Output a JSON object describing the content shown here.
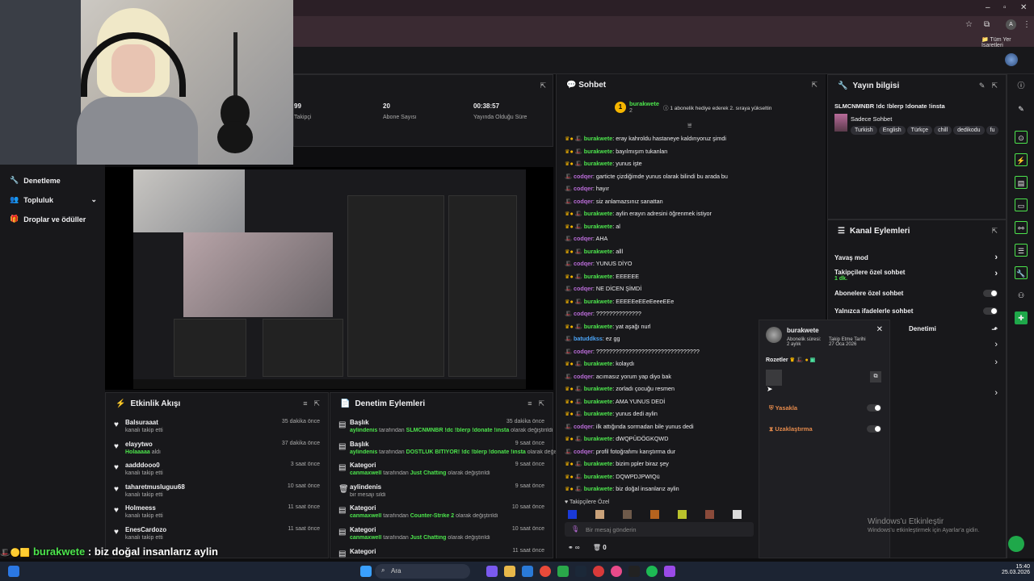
{
  "browser": {
    "bookmarks_label": "Tüm Yer İşaretleri",
    "window_controls": [
      "–",
      "▫",
      "✕"
    ]
  },
  "nav": {
    "items": [
      {
        "label": "Denetleme",
        "icon": "wrench-icon"
      },
      {
        "label": "Topluluk",
        "icon": "people-icon"
      },
      {
        "label": "Droplar ve ödüller",
        "icon": "gift-icon"
      }
    ]
  },
  "stats": {
    "items": [
      {
        "value": "99",
        "label": "Takipçi"
      },
      {
        "value": "20",
        "label": "Abone Sayısı"
      },
      {
        "value": "00:38:57",
        "label": "Yayında Olduğu Süre"
      }
    ]
  },
  "activity_feed": {
    "title": "Etkinlik Akışı",
    "items": [
      {
        "name": "Balsuraaat",
        "sub": "kanalı takip etti",
        "time": "35 dakika önce"
      },
      {
        "name": "elayytwo",
        "sub": "Holaaaaa",
        "sub2": " aldı",
        "time": "37 dakika önce"
      },
      {
        "name": "aadddooo0",
        "sub": "kanalı takip etti",
        "time": "3 saat önce"
      },
      {
        "name": "taharetmusluguu68",
        "sub": "kanalı takip etti",
        "time": "10 saat önce"
      },
      {
        "name": "Holmeess",
        "sub": "kanalı takip etti",
        "time": "11 saat önce"
      },
      {
        "name": "EnesCardozo",
        "sub": "kanalı takip etti",
        "time": "11 saat önce"
      }
    ]
  },
  "mod_actions": {
    "title": "Denetim Eylemleri",
    "items": [
      {
        "name": "Başlık",
        "user": "aylindenis",
        "mid": " tarafından ",
        "value": "SLMCNMNBR !dc !blerp !donate !insta",
        "suffix": " olarak değiştirildi",
        "time": "35 dakika önce"
      },
      {
        "name": "Başlık",
        "user": "aylindenis",
        "mid": " tarafından ",
        "value": "DOSTLUK BİTİYOR! !dc !blerp !donate !insta",
        "suffix": " olarak değiştirildi",
        "time": "9 saat önce"
      },
      {
        "name": "Kategori",
        "user": "canmaxwell",
        "mid": " tarafından ",
        "value": "Just Chatting",
        "suffix": " olarak değiştirildi",
        "time": "9 saat önce"
      },
      {
        "name": "aylindenis",
        "user": "",
        "mid": "",
        "value": "",
        "suffix": "bir mesajı sildi",
        "time": "9 saat önce"
      },
      {
        "name": "Kategori",
        "user": "canmaxwell",
        "mid": " tarafından ",
        "value": "Counter-Strike 2",
        "suffix": " olarak değiştirildi",
        "time": "10 saat önce"
      },
      {
        "name": "Kategori",
        "user": "canmaxwell",
        "mid": " tarafından ",
        "value": "Just Chatting",
        "suffix": " olarak değiştirildi",
        "time": "10 saat önce"
      },
      {
        "name": "Kategori",
        "user": "",
        "mid": "",
        "value": "",
        "suffix": "",
        "time": "11 saat önce"
      }
    ]
  },
  "chat": {
    "title": "Sohbet",
    "pinned_user": "burakwete",
    "pinned_count": "2",
    "pinned_text": "1 abonelik hediye ederek 2. sıraya yükseltin",
    "messages": [
      {
        "user": "burakwete",
        "cls": "user-burak",
        "text": "eray kahroldu hastaneye kaldırıyoruz şimdi"
      },
      {
        "user": "burakwete",
        "cls": "user-burak",
        "text": "bayılmışım tukanlan"
      },
      {
        "user": "burakwete",
        "cls": "user-burak",
        "text": "yunus işte"
      },
      {
        "user": "codqer",
        "cls": "user-codqer",
        "text": "garticte çizdiğimde yunus olarak bilindi bu arada bu"
      },
      {
        "user": "codqer",
        "cls": "user-codqer",
        "text": "hayır"
      },
      {
        "user": "codqer",
        "cls": "user-codqer",
        "text": "siz anlamazsınız sanattan"
      },
      {
        "user": "burakwete",
        "cls": "user-burak",
        "text": "aylin erayın adresini öğrenmek istiyor"
      },
      {
        "user": "burakwete",
        "cls": "user-burak",
        "text": "al"
      },
      {
        "user": "codqer",
        "cls": "user-codqer",
        "text": "AHA"
      },
      {
        "user": "burakwete",
        "cls": "user-burak",
        "text": "alll"
      },
      {
        "user": "codqer",
        "cls": "user-codqer",
        "text": "YUNUS DİYO"
      },
      {
        "user": "burakwete",
        "cls": "user-burak",
        "text": "EEEEEE"
      },
      {
        "user": "codqer",
        "cls": "user-codqer",
        "text": "NE DİCEN ŞİMDİ"
      },
      {
        "user": "burakwete",
        "cls": "user-burak",
        "text": "EEEEEeEEeEeeeEEe"
      },
      {
        "user": "codqer",
        "cls": "user-codqer",
        "text": "??????????????"
      },
      {
        "user": "burakwete",
        "cls": "user-burak",
        "text": "yat aşağı nurl"
      },
      {
        "user": "batuddkss",
        "cls": "user-batu",
        "text": "ez gg"
      },
      {
        "user": "codqer",
        "cls": "user-codqer",
        "text": "????????????????????????????????"
      },
      {
        "user": "burakwete",
        "cls": "user-burak",
        "text": "kolaydı"
      },
      {
        "user": "codqer",
        "cls": "user-codqer",
        "text": "acımasız yorum yap diyo bak"
      },
      {
        "user": "burakwete",
        "cls": "user-burak",
        "text": "zorladı çocuğu resmen"
      },
      {
        "user": "burakwete",
        "cls": "user-burak",
        "text": "AMA YUNUS DEDİ"
      },
      {
        "user": "burakwete",
        "cls": "user-burak",
        "text": "yunus dedi aylin"
      },
      {
        "user": "codqer",
        "cls": "user-codqer",
        "text": "ilk attığında sormadan bile yunus dedi"
      },
      {
        "user": "burakwete",
        "cls": "user-burak",
        "text": "dWQPÜDÖGKQWD"
      },
      {
        "user": "codqer",
        "cls": "user-codqer",
        "text": "profil fotoğrafımı karıştırma dur"
      },
      {
        "user": "burakwete",
        "cls": "user-burak",
        "text": "bizim ppler biraz şey"
      },
      {
        "user": "burakwete",
        "cls": "user-burak",
        "text": "DQWPDJPWIQü"
      },
      {
        "user": "burakwete",
        "cls": "user-burak",
        "text": "biz doğal insanlarız aylin"
      }
    ],
    "followers_label": "Takipçilere Özel",
    "input_placeholder": "Bir mesaj gönderin",
    "bottom_count": "0"
  },
  "stream_info": {
    "title": "Yayın bilgisi",
    "stream_title": "SLMCNMNBR !dc !blerp !donate !insta",
    "category": "Sadece Sohbet",
    "tags": [
      "Turkish",
      "English",
      "Türkçe",
      "chill",
      "dedikodu",
      "fu"
    ]
  },
  "channel_actions": {
    "title": "Kanal Eylemleri",
    "items": [
      {
        "label": "Yavaş mod",
        "type": "chevron"
      },
      {
        "label": "Takipçilere özel sohbet",
        "sub": "1 dk.",
        "type": "chevron"
      },
      {
        "label": "Abonelere özel sohbet",
        "type": "toggle"
      },
      {
        "label": "Yalnızca ifadelerle sohbet",
        "type": "toggle"
      }
    ],
    "partial_label": "Denetimi"
  },
  "user_card": {
    "name": "burakwete",
    "sub_label": "Abonelik süresi:",
    "sub_value": "2 aylık",
    "follow_label": "Takip Etme Tarihi",
    "follow_value": "27 Oca 2026",
    "badges_label": "Rozetler",
    "ban_label": "Yasakla",
    "timeout_label": "Uzaklaştırma"
  },
  "windows": {
    "activate_title": "Windows'u Etkinleştir",
    "activate_sub": "Windows'u etkinleştirmek için Ayarlar'a gidin.",
    "search_placeholder": "Ara",
    "time": "15:40",
    "date": "25.03.2026"
  },
  "overlay": {
    "user": "burakwete",
    "text": " : biz doğal insanlarız aylin"
  },
  "colors": {
    "accent_green": "#4ce44c",
    "bg": "#0e0e10",
    "panel": "#18181b"
  }
}
